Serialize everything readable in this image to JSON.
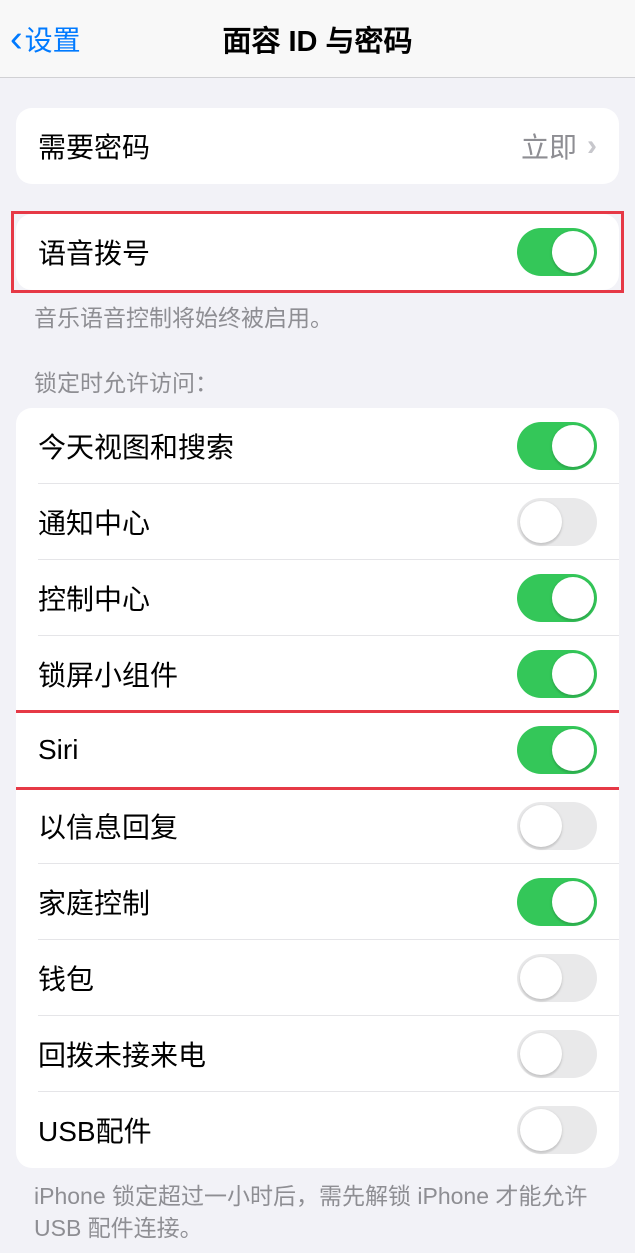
{
  "header": {
    "back_label": "设置",
    "title": "面容 ID 与密码"
  },
  "passcode_row": {
    "label": "需要密码",
    "value": "立即"
  },
  "voice_dial": {
    "label": "语音拨号",
    "on": true,
    "footer": "音乐语音控制将始终被启用。"
  },
  "lock_access": {
    "header": "锁定时允许访问：",
    "items": [
      {
        "label": "今天视图和搜索",
        "on": true,
        "key": "today-view"
      },
      {
        "label": "通知中心",
        "on": false,
        "key": "notification-center"
      },
      {
        "label": "控制中心",
        "on": true,
        "key": "control-center"
      },
      {
        "label": "锁屏小组件",
        "on": true,
        "key": "lock-screen-widgets"
      },
      {
        "label": "Siri",
        "on": true,
        "key": "siri",
        "highlighted": true
      },
      {
        "label": "以信息回复",
        "on": false,
        "key": "reply-with-message"
      },
      {
        "label": "家庭控制",
        "on": true,
        "key": "home-control"
      },
      {
        "label": "钱包",
        "on": false,
        "key": "wallet"
      },
      {
        "label": "回拨未接来电",
        "on": false,
        "key": "return-missed-calls"
      },
      {
        "label": "USB配件",
        "on": false,
        "key": "usb-accessories"
      }
    ],
    "footer": "iPhone 锁定超过一小时后，需先解锁 iPhone 才能允许 USB 配件连接。"
  }
}
